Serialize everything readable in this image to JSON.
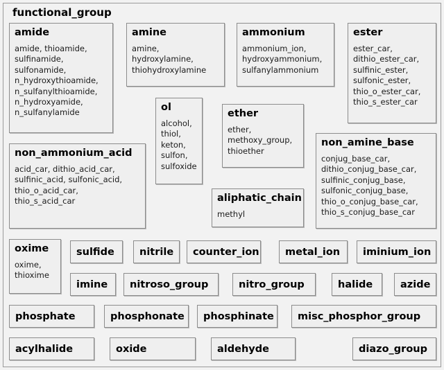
{
  "panel": {
    "title": "functional_group"
  },
  "groups": [
    {
      "name": "amide",
      "members": "amide, thioamide,\nsulfinamide,\nsulfonamide,\nn_hydroxythioamide,\nn_sulfanylthioamide,\nn_hydroxyamide,\nn_sulfanylamide"
    },
    {
      "name": "amine",
      "members": "amine,\nhydroxylamine,\nthiohydroxylamine"
    },
    {
      "name": "ammonium",
      "members": "ammonium_ion,\nhydroxyammonium,\nsulfanylammonium"
    },
    {
      "name": "ester",
      "members": "ester_car,\ndithio_ester_car,\nsulfinic_ester,\nsulfonic_ester,\nthio_o_ester_car,\nthio_s_ester_car"
    },
    {
      "name": "ol",
      "members": "alcohol,\nthiol,\nketon,\nsulfon,\nsulfoxide"
    },
    {
      "name": "ether",
      "members": "ether,\nmethoxy_group,\nthioether"
    },
    {
      "name": "non_ammonium_acid",
      "members": "acid_car, dithio_acid_car,\nsulfinic_acid, sulfonic_acid,\nthio_o_acid_car,\nthio_s_acid_car"
    },
    {
      "name": "aliphatic_chain",
      "members": "methyl"
    },
    {
      "name": "non_amine_base",
      "members": "conjug_base_car,\ndithio_conjug_base_car,\nsulfinic_conjug_base,\nsulfonic_conjug_base,\nthio_o_conjug_base_car,\nthio_s_conjug_base_car"
    },
    {
      "name": "oxime",
      "members": "oxime,\nthioxime"
    }
  ],
  "leaves": [
    {
      "name": "sulfide"
    },
    {
      "name": "nitrile"
    },
    {
      "name": "counter_ion"
    },
    {
      "name": "metal_ion"
    },
    {
      "name": "iminium_ion"
    },
    {
      "name": "imine"
    },
    {
      "name": "nitroso_group"
    },
    {
      "name": "nitro_group"
    },
    {
      "name": "halide"
    },
    {
      "name": "azide"
    },
    {
      "name": "phosphate"
    },
    {
      "name": "phosphonate"
    },
    {
      "name": "phosphinate"
    },
    {
      "name": "misc_phosphor_group"
    },
    {
      "name": "acylhalide"
    },
    {
      "name": "oxide"
    },
    {
      "name": "aldehyde"
    },
    {
      "name": "diazo_group"
    }
  ]
}
